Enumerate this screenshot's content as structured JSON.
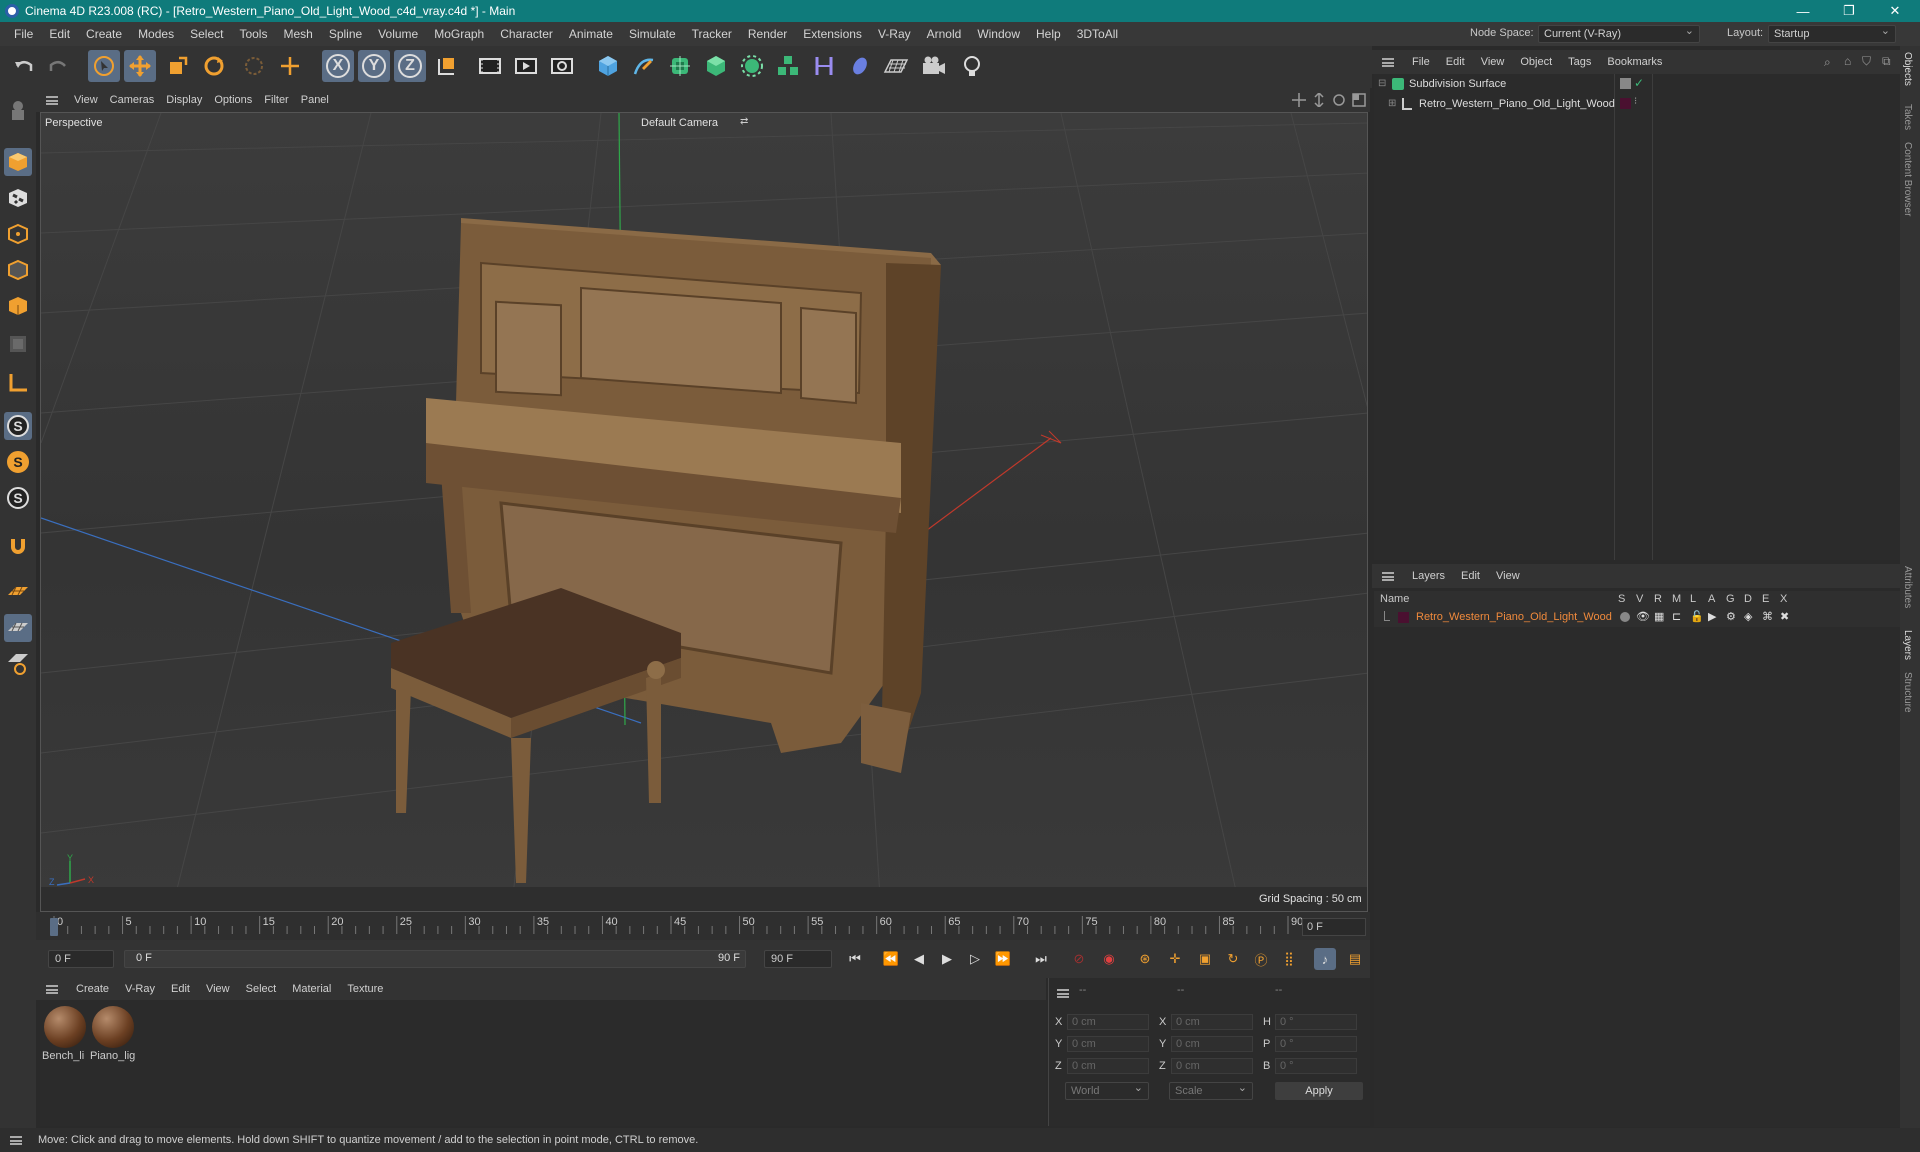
{
  "window": {
    "title": "Cinema 4D R23.008 (RC) - [Retro_Western_Piano_Old_Light_Wood_c4d_vray.c4d *] - Main",
    "controls": {
      "minimize": "—",
      "restore": "❐",
      "close": "✕"
    }
  },
  "menubar": {
    "items": [
      "File",
      "Edit",
      "Create",
      "Modes",
      "Select",
      "Tools",
      "Mesh",
      "Spline",
      "Volume",
      "MoGraph",
      "Character",
      "Animate",
      "Simulate",
      "Tracker",
      "Render",
      "Extensions",
      "V-Ray",
      "Arnold",
      "Window",
      "Help",
      "3DToAll"
    ],
    "node_space_label": "Node Space:",
    "node_space_value": "Current (V-Ray)",
    "layout_label": "Layout:",
    "layout_value": "Startup"
  },
  "toolbar": {
    "axis_labels": [
      "X",
      "Y",
      "Z"
    ]
  },
  "left_palette": {
    "letter_icons": [
      "S",
      "S",
      "S"
    ]
  },
  "viewport": {
    "menu": [
      "View",
      "Cameras",
      "Display",
      "Options",
      "Filter",
      "Panel"
    ],
    "view_name": "Perspective",
    "camera_name": "Default Camera",
    "grid_spacing": "Grid Spacing : 50 cm",
    "axis_x": "X",
    "axis_y": "Y",
    "axis_z": "Z"
  },
  "timeline": {
    "ticks": [
      "0",
      "5",
      "10",
      "15",
      "20",
      "25",
      "30",
      "35",
      "40",
      "45",
      "50",
      "55",
      "60",
      "65",
      "70",
      "75",
      "80",
      "85",
      "90"
    ],
    "current_frame_display": "0 F"
  },
  "transport": {
    "start_field": "0 F",
    "range_start": "0 F",
    "range_end": "90 F",
    "end_field": "90 F"
  },
  "materials": {
    "menu": [
      "Create",
      "V-Ray",
      "Edit",
      "View",
      "Select",
      "Material",
      "Texture"
    ],
    "items": [
      {
        "name": "Bench_li"
      },
      {
        "name": "Piano_lig"
      }
    ]
  },
  "coordinates": {
    "header": [
      "--",
      "--",
      "--"
    ],
    "rows": [
      {
        "a": "X",
        "a_val": "0 cm",
        "b": "X",
        "b_val": "0 cm",
        "c": "H",
        "c_val": "0 °"
      },
      {
        "a": "Y",
        "a_val": "0 cm",
        "b": "Y",
        "b_val": "0 cm",
        "c": "P",
        "c_val": "0 °"
      },
      {
        "a": "Z",
        "a_val": "0 cm",
        "b": "Z",
        "b_val": "0 cm",
        "c": "B",
        "c_val": "0 °"
      }
    ],
    "mode_world": "World",
    "mode_scale": "Scale",
    "apply_label": "Apply"
  },
  "objects_panel": {
    "menu": [
      "File",
      "Edit",
      "View",
      "Object",
      "Tags",
      "Bookmarks"
    ],
    "tree": [
      {
        "name": "Subdivision Surface"
      },
      {
        "name": "Retro_Western_Piano_Old_Light_Wood"
      }
    ]
  },
  "layers_panel": {
    "menu": [
      "Layers",
      "Edit",
      "View"
    ],
    "columns": [
      "Name",
      "S",
      "V",
      "R",
      "M",
      "L",
      "A",
      "G",
      "D",
      "E",
      "X"
    ],
    "rows": [
      {
        "name": "Retro_Western_Piano_Old_Light_Wood",
        "color": "#f08a3c"
      }
    ]
  },
  "side_tabs": [
    "Objects",
    "Takes",
    "Content Browser",
    "Attributes",
    "Layers",
    "Structure"
  ],
  "status": {
    "message": "Move: Click and drag to move elements. Hold down SHIFT to quantize movement / add to the selection in point mode, CTRL to remove."
  }
}
